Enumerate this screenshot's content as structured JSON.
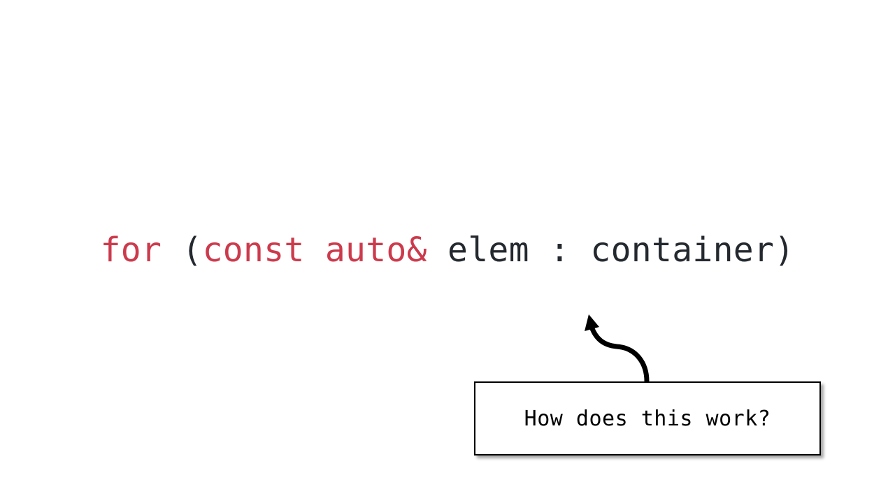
{
  "code": {
    "tokens": [
      {
        "text": "for",
        "role": "keyword"
      },
      {
        "text": " (",
        "role": "plain"
      },
      {
        "text": "const",
        "role": "keyword"
      },
      {
        "text": " ",
        "role": "plain"
      },
      {
        "text": "auto&",
        "role": "keyword"
      },
      {
        "text": " elem : container)",
        "role": "plain"
      }
    ]
  },
  "callout": {
    "text": "How does this work?"
  },
  "colors": {
    "keyword": "#cc3a4c",
    "plain": "#24292f",
    "background": "#ffffff"
  }
}
